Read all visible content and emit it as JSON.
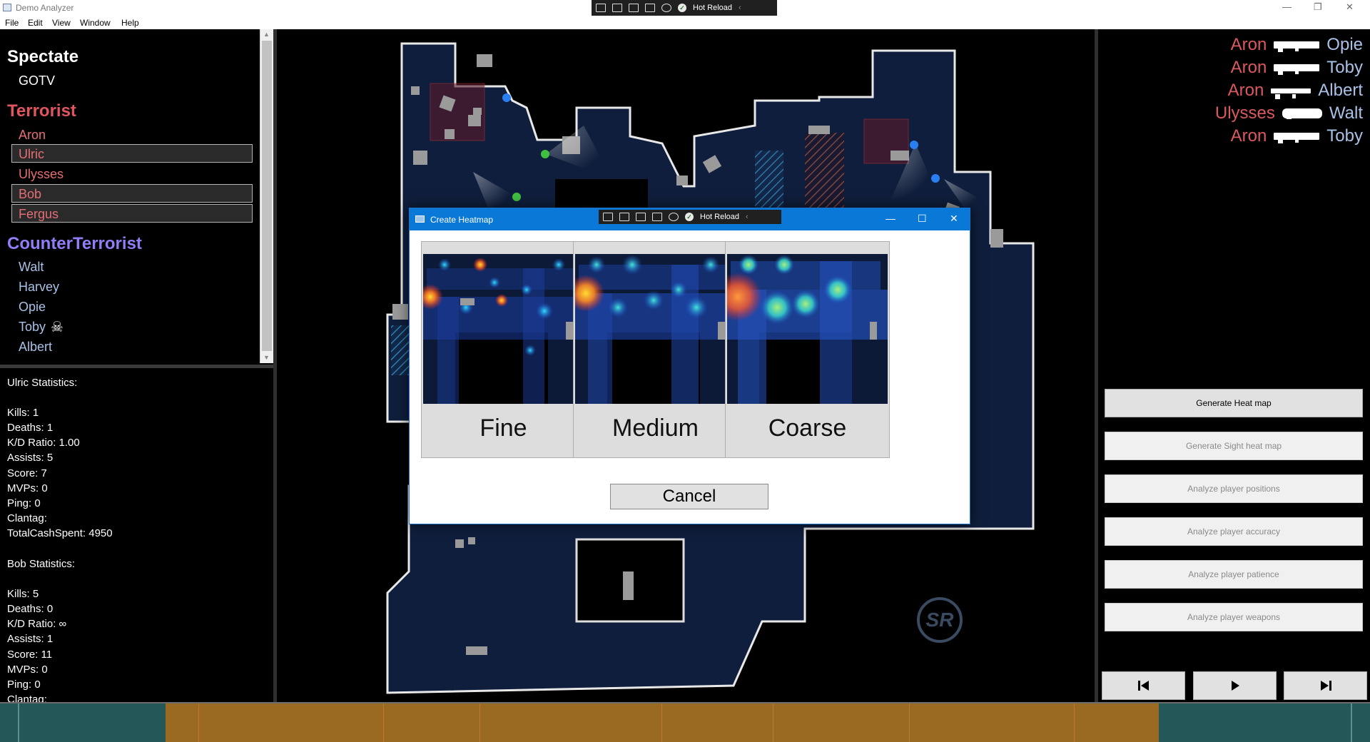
{
  "app": {
    "title": "Demo Analyzer"
  },
  "devtools": {
    "hot_reload": "Hot Reload"
  },
  "menu": [
    "File",
    "Edit",
    "View",
    "Window",
    "Help"
  ],
  "players": {
    "spectate": {
      "heading": "Spectate",
      "items": [
        "GOTV"
      ]
    },
    "terrorist": {
      "heading": "Terrorist",
      "color": "#e05560",
      "items": [
        "Aron",
        "Ulric",
        "Ulysses",
        "Bob",
        "Fergus"
      ],
      "selected": [
        "Ulric",
        "Bob",
        "Fergus"
      ]
    },
    "counter_terrorist": {
      "heading": "CounterTerrorist",
      "color": "#8f7ef5",
      "items": [
        "Walt",
        "Harvey",
        "Opie",
        "Toby",
        "Albert"
      ],
      "dead": [
        "Toby"
      ]
    }
  },
  "stats": {
    "ulric": {
      "heading": "Ulric Statistics:",
      "lines": [
        "Kills: 1",
        "Deaths: 1",
        "K/D Ratio: 1.00",
        "Assists: 5",
        "Score: 7",
        "MVPs: 0",
        "Ping: 0",
        "Clantag:",
        "TotalCashSpent: 4950"
      ]
    },
    "bob": {
      "heading": "Bob Statistics:",
      "lines": [
        "Kills: 5",
        "Deaths: 0",
        "K/D Ratio: ∞",
        "Assists: 1",
        "Score: 11",
        "MVPs: 0",
        "Ping: 0",
        "Clantag:"
      ]
    }
  },
  "killfeed": [
    {
      "killer": "Aron",
      "victim": "Opie",
      "weapon": "sniper-rifle-icon"
    },
    {
      "killer": "Aron",
      "victim": "Toby",
      "weapon": "sniper-rifle-icon"
    },
    {
      "killer": "Aron",
      "victim": "Albert",
      "weapon": "rifle-icon"
    },
    {
      "killer": "Ulysses",
      "victim": "Walt",
      "weapon": "heavy-weapon-icon"
    },
    {
      "killer": "Aron",
      "victim": "Toby",
      "weapon": "sniper-rifle-icon"
    }
  ],
  "actions": {
    "heatmap": "Generate Heat map",
    "sight_heatmap": "Generate Sight heat map",
    "positions": "Analyze player positions",
    "accuracy": "Analyze player accuracy",
    "patience": "Analyze player patience",
    "weapons": "Analyze player weapons"
  },
  "dialog": {
    "title": "Create Heatmap",
    "options": [
      "Fine",
      "Medium",
      "Coarse"
    ],
    "cancel": "Cancel"
  },
  "map": {
    "logo": "SR"
  },
  "colors": {
    "terrorist": "#e05560",
    "counter_terrorist": "#8f7ef5",
    "ct_name": "#a9c1e6",
    "map_fill": "#0f1e3c",
    "timeline_round": "#9a6a22",
    "timeline_bg": "#245858"
  }
}
